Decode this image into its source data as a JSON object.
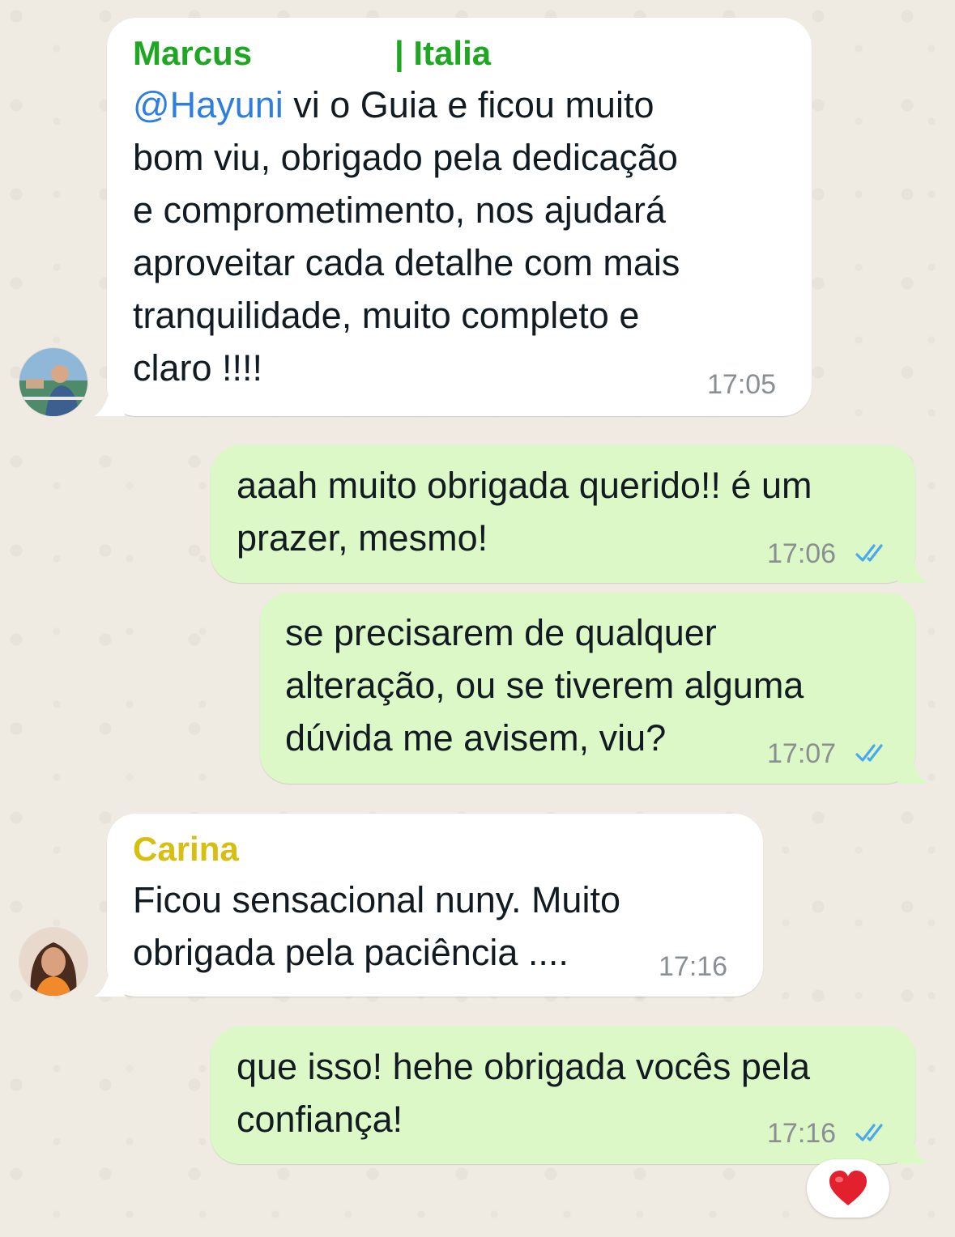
{
  "colors": {
    "background": "#efeae2",
    "incoming_bubble": "#ffffff",
    "outgoing_bubble": "#dcf8c6",
    "sender_marcus": "#1fa723",
    "sender_carina": "#d8be0e",
    "mention": "#2e7ee0",
    "read_ticks": "#4aa8f0",
    "reaction_heart": "#e3212e"
  },
  "messages": [
    {
      "direction": "incoming",
      "sender": "Marcus",
      "sender_tag": "| Italia",
      "mention": "@Hayuni",
      "lines": [
        " vi o Guia e ficou muito",
        "bom viu, obrigado pela dedicação",
        "e comprometimento, nos ajudará",
        "aproveitar cada detalhe com mais",
        "tranquilidade, muito completo e",
        "claro !!!!"
      ],
      "time": "17:05",
      "avatar_icon": "user-avatar-marcus"
    },
    {
      "direction": "outgoing",
      "lines": [
        "aaah muito obrigada querido!! é um",
        "prazer, mesmo!"
      ],
      "time": "17:06",
      "status_icon": "double-check-read-icon"
    },
    {
      "direction": "outgoing",
      "lines": [
        "se precisarem de qualquer",
        "alteração, ou se tiverem alguma",
        "dúvida me avisem, viu?"
      ],
      "time": "17:07",
      "status_icon": "double-check-read-icon"
    },
    {
      "direction": "incoming",
      "sender": "Carina",
      "lines": [
        "Ficou sensacional nuny. Muito",
        "obrigada pela paciência ...."
      ],
      "time": "17:16",
      "avatar_icon": "user-avatar-carina"
    },
    {
      "direction": "outgoing",
      "lines": [
        "que isso! hehe obrigada vocês pela",
        "confiança!"
      ],
      "time": "17:16",
      "status_icon": "double-check-read-icon",
      "reaction": "❤️"
    }
  ]
}
